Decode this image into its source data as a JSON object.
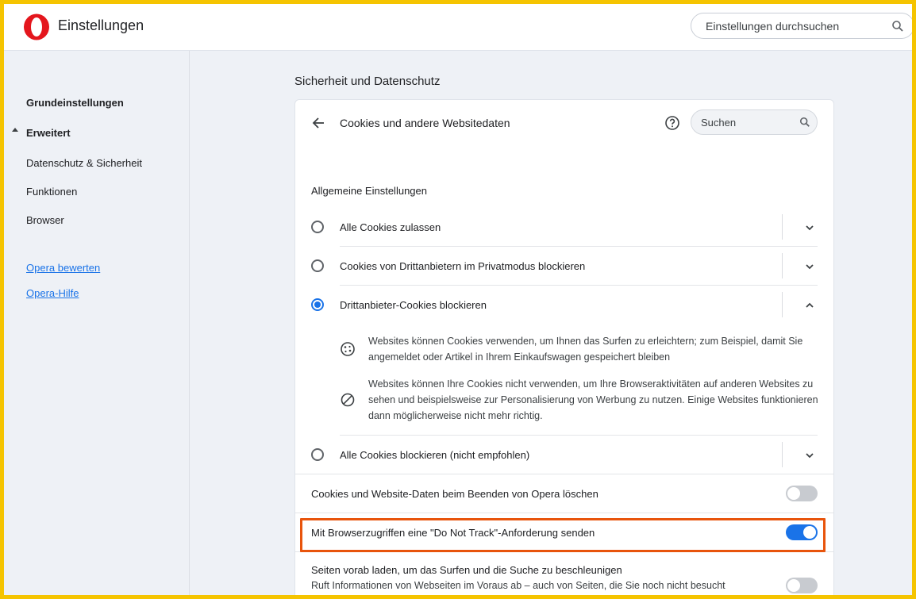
{
  "header": {
    "app_title": "Einstellungen",
    "search_placeholder": "Einstellungen durchsuchen"
  },
  "sidebar": {
    "items": [
      {
        "label": "Grundeinstellungen"
      },
      {
        "label": "Erweitert"
      },
      {
        "label": "Datenschutz & Sicherheit"
      },
      {
        "label": "Funktionen"
      },
      {
        "label": "Browser"
      }
    ],
    "links": [
      {
        "label": "Opera bewerten"
      },
      {
        "label": "Opera-Hilfe"
      }
    ]
  },
  "main": {
    "section_title": "Sicherheit und Datenschutz",
    "card": {
      "title": "Cookies und andere Websitedaten",
      "search_placeholder": "Suchen",
      "subheading": "Allgemeine Einstellungen",
      "options": [
        {
          "label": "Alle Cookies zulassen",
          "checked": false,
          "expanded": false
        },
        {
          "label": "Cookies von Drittanbietern im Privatmodus blockieren",
          "checked": false,
          "expanded": false
        },
        {
          "label": "Drittanbieter-Cookies blockieren",
          "checked": true,
          "expanded": true
        },
        {
          "label": "Alle Cookies blockieren (nicht empfohlen)",
          "checked": false,
          "expanded": false
        }
      ],
      "details": [
        {
          "icon": "cookie-icon",
          "text": "Websites können Cookies verwenden, um Ihnen das Surfen zu erleichtern; zum Beispiel, damit Sie angemeldet oder Artikel in Ihrem Einkaufswagen gespeichert bleiben"
        },
        {
          "icon": "block-icon",
          "text": "Websites können Ihre Cookies nicht verwenden, um Ihre Browseraktivitäten auf anderen Websites zu sehen und beispielsweise zur Personalisierung von Werbung zu nutzen. Einige Websites funktionieren dann möglicherweise nicht mehr richtig."
        }
      ],
      "toggles": [
        {
          "label": "Cookies und Website-Daten beim Beenden von Opera löschen",
          "on": false
        },
        {
          "label": "Mit Browserzugriffen eine \"Do Not Track\"-Anforderung senden",
          "on": true
        },
        {
          "label": "Seiten vorab laden, um das Surfen und die Suche zu beschleunigen",
          "sublabel": "Ruft Informationen von Webseiten im Voraus ab – auch von Seiten, die Sie noch nicht besucht",
          "on": false
        }
      ]
    }
  },
  "colors": {
    "accent": "#1a73e8",
    "highlight_border": "#e8540c",
    "outer_frame": "#f5c400",
    "opera_red": "#e4161d"
  }
}
